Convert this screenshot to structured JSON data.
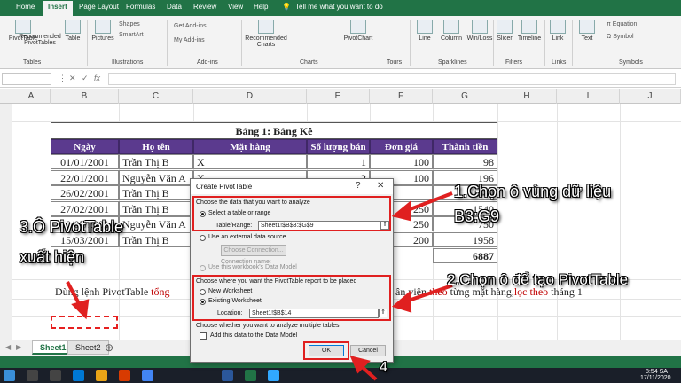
{
  "ribbon": {
    "tabs": [
      "Home",
      "Insert",
      "Page Layout",
      "Formulas",
      "Data",
      "Review",
      "View",
      "Help"
    ],
    "active_tab": "Insert",
    "tell_me": "Tell me what you want to do",
    "buttons": {
      "pivot_table": "PivotTable",
      "recommended_pivot": "Recommended PivotTables",
      "table": "Table",
      "pictures": "Pictures",
      "get_addins": "Get Add-ins",
      "my_addins": "My Add-ins",
      "recommended_charts": "Recommended Charts",
      "pivot_chart": "PivotChart",
      "line": "Line",
      "column": "Column",
      "win_loss": "Win/Loss",
      "slicer": "Slicer",
      "timeline": "Timeline",
      "link": "Link",
      "text": "Text",
      "equation": "Equation",
      "symbol": "Symbol",
      "shapes": "Shapes",
      "smartart": "SmartArt"
    },
    "groups": [
      "Tables",
      "Illustrations",
      "Add-ins",
      "Charts",
      "Tours",
      "Sparklines",
      "Filters",
      "Links",
      "Symbols"
    ]
  },
  "columns": [
    "A",
    "B",
    "C",
    "D",
    "E",
    "F",
    "G",
    "H",
    "I",
    "J"
  ],
  "table": {
    "title": "Bảng 1: Bảng Kê",
    "headers": [
      "Ngày",
      "Họ tên",
      "Mặt hàng",
      "Số lượng bán",
      "Đơn giá",
      "Thành tiền"
    ],
    "rows": [
      [
        "01/01/2001",
        "Trần Thị B",
        "X",
        "1",
        "100",
        "98"
      ],
      [
        "22/01/2001",
        "Nguyễn Văn A",
        "X",
        "2",
        "100",
        "196"
      ],
      [
        "26/02/2001",
        "Trần Thị B",
        "",
        "",
        "",
        "1540"
      ],
      [
        "27/02/2001",
        "Trần Thị B",
        "",
        "",
        "250",
        "1540"
      ],
      [
        "10/03/2001",
        "Nguyễn Văn A",
        "",
        "",
        "250",
        "750"
      ],
      [
        "15/03/2001",
        "Trần Thị B",
        "",
        "",
        "200",
        "1958"
      ]
    ],
    "total": "6887"
  },
  "note": {
    "left": "Dùng lệnh PivotTable",
    "left_red": "tổng",
    "right_pre": "ân viên",
    "right_red1": "theo",
    "right_mid": "từng mặt hàng,",
    "right_red2": "lọc theo",
    "right_end": "tháng 1"
  },
  "sheets": [
    "Sheet1",
    "Sheet2"
  ],
  "active_sheet": "Sheet1",
  "taskbar": {
    "time": "8:54 SA",
    "date": "17/11/2020"
  },
  "dialog": {
    "title": "Create PivotTable",
    "help": "?",
    "close": "✕",
    "section1": "Choose the data that you want to analyze",
    "opt_select_table": "Select a table or range",
    "table_range_label": "Table/Range:",
    "table_range_value": "Sheet1!$B$3:$G$9",
    "opt_external": "Use an external data source",
    "choose_connection": "Choose Connection...",
    "connection_name": "Connection name:",
    "opt_data_model": "Use this workbook's Data Model",
    "section2": "Choose where you want the PivotTable report to be placed",
    "opt_new_ws": "New Worksheet",
    "opt_existing_ws": "Existing Worksheet",
    "location_label": "Location:",
    "location_value": "Sheet1!$B$14",
    "section3": "Choose whether you want to analyze multiple tables",
    "add_data_model": "Add this data to the Data Model",
    "ok": "OK",
    "cancel": "Cancel"
  },
  "annotations": {
    "step1_line1": "1.Chọn ô vùng dữ liệu",
    "step1_line2": "B3:G9",
    "step2": "2.Chọn ô để tạo PivotTable",
    "step3_line1": "3.Ô PivotTable",
    "step3_line2": "xuất hiện",
    "step4": "4"
  },
  "colors": {
    "excel_green": "#217346",
    "header_purple": "#5b3a8e",
    "highlight_red": "#e02020"
  }
}
